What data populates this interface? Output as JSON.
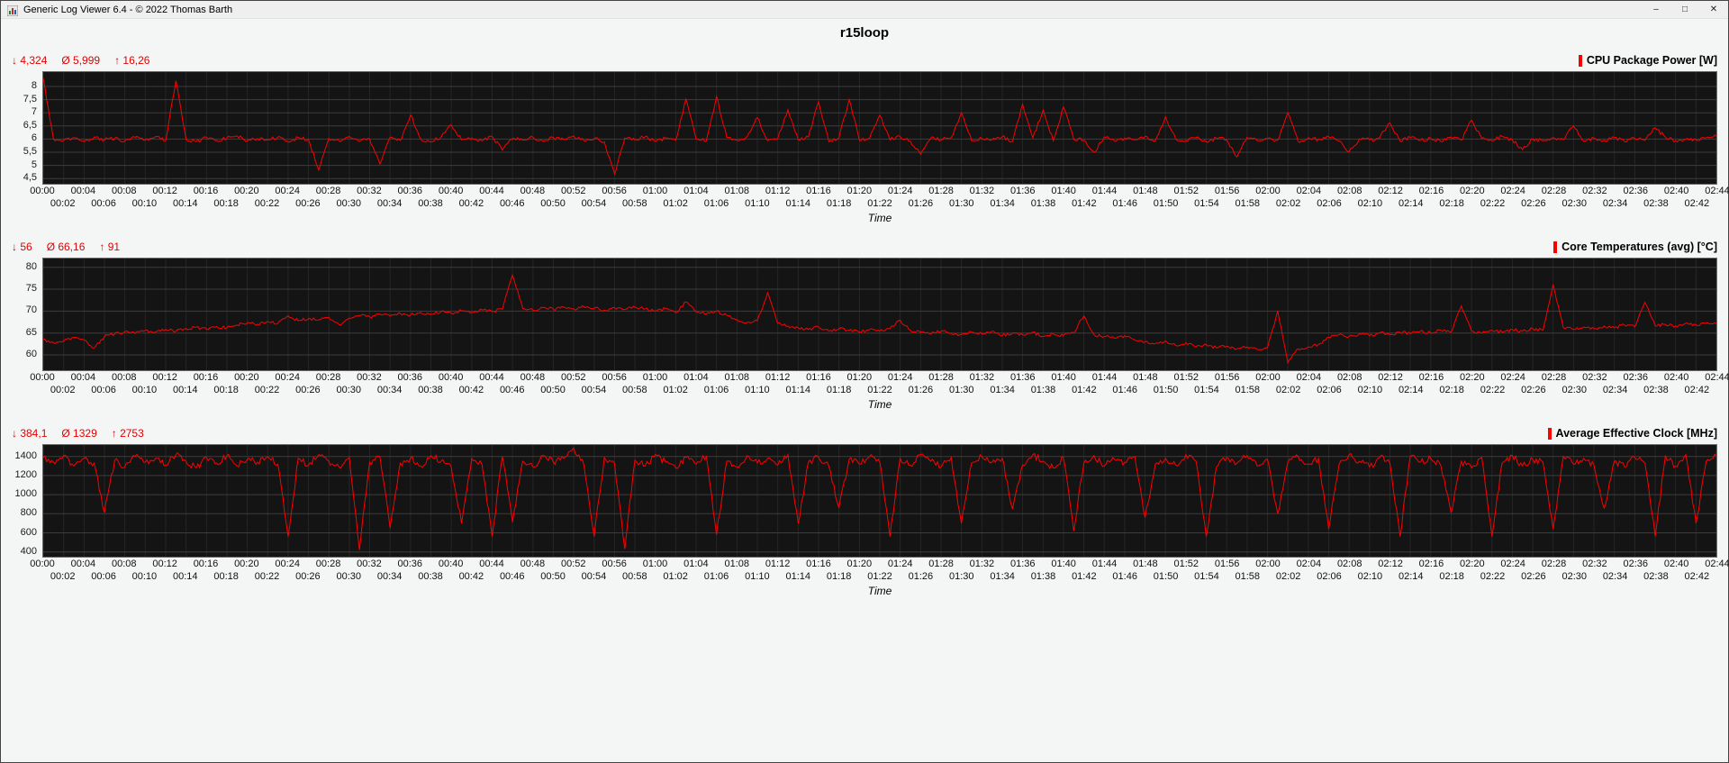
{
  "window": {
    "title": "Generic Log Viewer 6.4 - © 2022 Thomas Barth",
    "minimize": "–",
    "maximize": "□",
    "close": "✕"
  },
  "page_title": "r15loop",
  "time_axis_label": "Time",
  "accent_color": "#ff0000",
  "x_tick_labels": [
    "00:00",
    "00:02",
    "00:04",
    "00:06",
    "00:08",
    "00:10",
    "00:12",
    "00:14",
    "00:16",
    "00:18",
    "00:20",
    "00:22",
    "00:24",
    "00:26",
    "00:28",
    "00:30",
    "00:32",
    "00:34",
    "00:36",
    "00:38",
    "00:40",
    "00:42",
    "00:44",
    "00:46",
    "00:48",
    "00:50",
    "00:52",
    "00:54",
    "00:56",
    "00:58",
    "01:00",
    "01:02",
    "01:04",
    "01:06",
    "01:08",
    "01:10",
    "01:12",
    "01:14",
    "01:16",
    "01:18",
    "01:20",
    "01:22",
    "01:24",
    "01:26",
    "01:28",
    "01:30",
    "01:32",
    "01:34",
    "01:36",
    "01:38",
    "01:40",
    "01:42",
    "01:44",
    "01:46",
    "01:48",
    "01:50",
    "01:52",
    "01:54",
    "01:56",
    "01:58",
    "02:00",
    "02:02",
    "02:04",
    "02:06",
    "02:08",
    "02:10",
    "02:12",
    "02:14",
    "02:16",
    "02:18",
    "02:20",
    "02:22",
    "02:24",
    "02:26",
    "02:28",
    "02:30",
    "02:32",
    "02:34",
    "02:36",
    "02:38",
    "02:40",
    "02:42",
    "02:44"
  ],
  "chart_data": [
    {
      "type": "line",
      "title": "CPU Package Power [W]",
      "color": "#ff0000",
      "stats": [
        {
          "symbol": "↓",
          "value": "4,324"
        },
        {
          "symbol": "Ø",
          "value": "5,999"
        },
        {
          "symbol": "↑",
          "value": "16,26"
        }
      ],
      "xlabel": "Time",
      "x_minutes_range": [
        0,
        164
      ],
      "x_step_minutes": 1,
      "ylim": [
        4.3,
        8.55
      ],
      "yticks": [
        {
          "label": "8",
          "v": 8
        },
        {
          "label": "7,5",
          "v": 7.5
        },
        {
          "label": "7",
          "v": 7
        },
        {
          "label": "6,5",
          "v": 6.5
        },
        {
          "label": "6",
          "v": 6
        },
        {
          "label": "5,5",
          "v": 5.5
        },
        {
          "label": "5",
          "v": 5
        },
        {
          "label": "4,5",
          "v": 4.5
        }
      ],
      "noise": 0.07,
      "values": [
        8.32,
        6,
        5.95,
        6.05,
        5.9,
        6.08,
        5.97,
        6.03,
        5.92,
        6.06,
        5.96,
        6.1,
        5.94,
        8.22,
        6,
        5.9,
        6.07,
        5.95,
        6.04,
        6.12,
        5.93,
        6.02,
        5.97,
        6.08,
        5.9,
        6.05,
        5.98,
        4.82,
        6.03,
        5.94,
        6.1,
        5.92,
        6,
        5.05,
        6.06,
        5.95,
        6.92,
        6,
        5.9,
        6.08,
        6.55,
        5.97,
        6.04,
        5.93,
        6.1,
        5.58,
        6.02,
        5.96,
        6.07,
        5.91,
        6.05,
        5.98,
        6.12,
        5.94,
        6.01,
        5.9,
        4.68,
        6.04,
        5.97,
        6.09,
        5.92,
        6.03,
        5.95,
        7.52,
        6,
        5.93,
        7.62,
        6.06,
        5.96,
        6.1,
        6.82,
        5.94,
        6.02,
        7.12,
        5.98,
        6.08,
        7.42,
        5.9,
        6.05,
        7.5,
        5.95,
        6.03,
        6.9,
        5.97,
        6.1,
        5.92,
        5.42,
        6.04,
        5.96,
        6.07,
        7,
        5.93,
        6.02,
        5.98,
        6.09,
        5.91,
        7.32,
        6.05,
        7.1,
        5.94,
        7.22,
        6,
        5.96,
        5.5,
        6.08,
        5.92,
        6.04,
        5.97,
        6.1,
        5.93,
        6.85,
        6.01,
        5.95,
        6.06,
        5.9,
        6.03,
        5.98,
        5.32,
        6.07,
        5.94,
        6.02,
        5.96,
        7,
        5.91,
        6.05,
        5.99,
        6.09,
        5.93,
        5.52,
        6,
        5.97,
        6.04,
        6.62,
        5.92,
        6.06,
        5.95,
        6.02,
        5.9,
        6.08,
        5.96,
        6.72,
        6.03,
        5.94,
        6.1,
        5.97,
        5.6,
        6.01,
        5.93,
        6.05,
        5.98,
        6.5,
        5.92,
        6.04,
        5.96,
        6.07,
        5.9,
        6.02,
        5.95,
        6.42,
        6.08,
        5.94,
        6,
        5.97,
        6.05,
        6.1
      ]
    },
    {
      "type": "line",
      "title": "Core Temperatures (avg) [°C]",
      "color": "#ff0000",
      "stats": [
        {
          "symbol": "↓",
          "value": "56"
        },
        {
          "symbol": "Ø",
          "value": "66,16"
        },
        {
          "symbol": "↑",
          "value": "91"
        }
      ],
      "xlabel": "Time",
      "x_minutes_range": [
        0,
        164
      ],
      "x_step_minutes": 1,
      "ylim": [
        56.5,
        82
      ],
      "yticks": [
        {
          "label": "80",
          "v": 80
        },
        {
          "label": "75",
          "v": 75
        },
        {
          "label": "70",
          "v": 70
        },
        {
          "label": "65",
          "v": 65
        },
        {
          "label": "60",
          "v": 60
        }
      ],
      "noise": 0.35,
      "values": [
        63.5,
        62.8,
        63.2,
        64,
        63.4,
        61.6,
        64.2,
        64.8,
        65.3,
        64.9,
        65.6,
        65.2,
        65.8,
        65.4,
        66,
        66.3,
        65.9,
        66.5,
        66.2,
        66.8,
        67.3,
        67,
        67.6,
        67.2,
        68.9,
        67.8,
        68.3,
        68,
        68.6,
        66.9,
        68.4,
        69,
        68.7,
        69.3,
        68.9,
        69.5,
        69.1,
        69.7,
        69.3,
        69.9,
        69.5,
        70.1,
        69.7,
        70.3,
        69.9,
        70.4,
        78.2,
        70.6,
        70.2,
        70.8,
        70.4,
        70.9,
        70.5,
        71,
        70.6,
        70.2,
        70.8,
        70.4,
        70.9,
        70.5,
        70,
        70.6,
        69.6,
        72.1,
        69.8,
        69.4,
        70,
        69,
        68,
        67.4,
        67.8,
        74.2,
        67.2,
        66.6,
        66.2,
        65.8,
        66.4,
        65.4,
        66,
        65.6,
        65.2,
        65.8,
        65.4,
        66,
        67.9,
        65.6,
        65.2,
        64.8,
        65.4,
        65,
        64.6,
        65.2,
        64.8,
        65.4,
        64.4,
        65,
        64.6,
        65.2,
        64.2,
        64.8,
        64.4,
        65,
        68.9,
        64.6,
        64.2,
        63.8,
        64.4,
        63.4,
        63,
        62.6,
        63.2,
        62.2,
        62.8,
        61.8,
        62.4,
        61.6,
        62,
        61.4,
        61.8,
        61.2,
        61.6,
        70.1,
        58.2,
        61.4,
        61.8,
        62.4,
        64,
        64.6,
        64.2,
        64.8,
        64.4,
        65,
        64.6,
        65.2,
        64.8,
        65.4,
        65,
        65.6,
        65.2,
        71.2,
        65.4,
        65,
        65.6,
        65.2,
        65.8,
        65.4,
        66,
        65.6,
        76.1,
        66.2,
        65.8,
        66.4,
        66,
        66.6,
        66.2,
        66.8,
        66.4,
        72,
        66.6,
        67,
        66.6,
        67.2,
        66.8,
        67.3,
        67
      ]
    },
    {
      "type": "line",
      "title": "Average Effective Clock [MHz]",
      "color": "#ff0000",
      "stats": [
        {
          "symbol": "↓",
          "value": "384,1"
        },
        {
          "symbol": "Ø",
          "value": "1329"
        },
        {
          "symbol": "↑",
          "value": "2753"
        }
      ],
      "xlabel": "Time",
      "x_minutes_range": [
        0,
        164
      ],
      "x_step_minutes": 1,
      "ylim": [
        350,
        1520
      ],
      "yticks": [
        {
          "label": "1400",
          "v": 1400
        },
        {
          "label": "1200",
          "v": 1200
        },
        {
          "label": "1000",
          "v": 1000
        },
        {
          "label": "800",
          "v": 800
        },
        {
          "label": "600",
          "v": 600
        },
        {
          "label": "400",
          "v": 400
        }
      ],
      "noise": 35,
      "values": [
        1390,
        1340,
        1410,
        1300,
        1380,
        1330,
        810,
        1360,
        1290,
        1400,
        1340,
        1380,
        1310,
        1420,
        1350,
        1280,
        1390,
        1330,
        1410,
        1300,
        1370,
        1340,
        1400,
        1320,
        560,
        1380,
        1310,
        1420,
        1350,
        1290,
        1390,
        420,
        1340,
        1400,
        650,
        1330,
        1380,
        1300,
        1410,
        1350,
        1290,
        700,
        1380,
        1320,
        560,
        1400,
        710,
        1350,
        1290,
        1410,
        1340,
        1380,
        1490,
        1310,
        560,
        1390,
        1330,
        430,
        1360,
        1300,
        1420,
        1340,
        1280,
        1390,
        1320,
        1400,
        580,
        1350,
        1290,
        1410,
        1330,
        1380,
        1310,
        1420,
        700,
        1340,
        1390,
        1300,
        860,
        1370,
        1320,
        1400,
        1340,
        560,
        1380,
        1310,
        1420,
        1350,
        1290,
        1390,
        700,
        1330,
        1400,
        1340,
        1380,
        850,
        1310,
        1420,
        1350,
        1280,
        1390,
        620,
        1330,
        1410,
        1300,
        1370,
        1340,
        1400,
        760,
        1320,
        1380,
        1310,
        1420,
        1350,
        560,
        1290,
        1390,
        1330,
        1410,
        1300,
        1370,
        800,
        1340,
        1400,
        1320,
        1380,
        640,
        1310,
        1420,
        1350,
        1290,
        1390,
        1330,
        560,
        1400,
        1340,
        1380,
        1300,
        810,
        1350,
        1280,
        1390,
        560,
        1330,
        1410,
        1300,
        1370,
        1340,
        640,
        1400,
        1320,
        1380,
        1310,
        860,
        1350,
        1290,
        1390,
        1330,
        560,
        1410,
        1300,
        1420,
        700,
        1350,
        1400
      ]
    }
  ]
}
